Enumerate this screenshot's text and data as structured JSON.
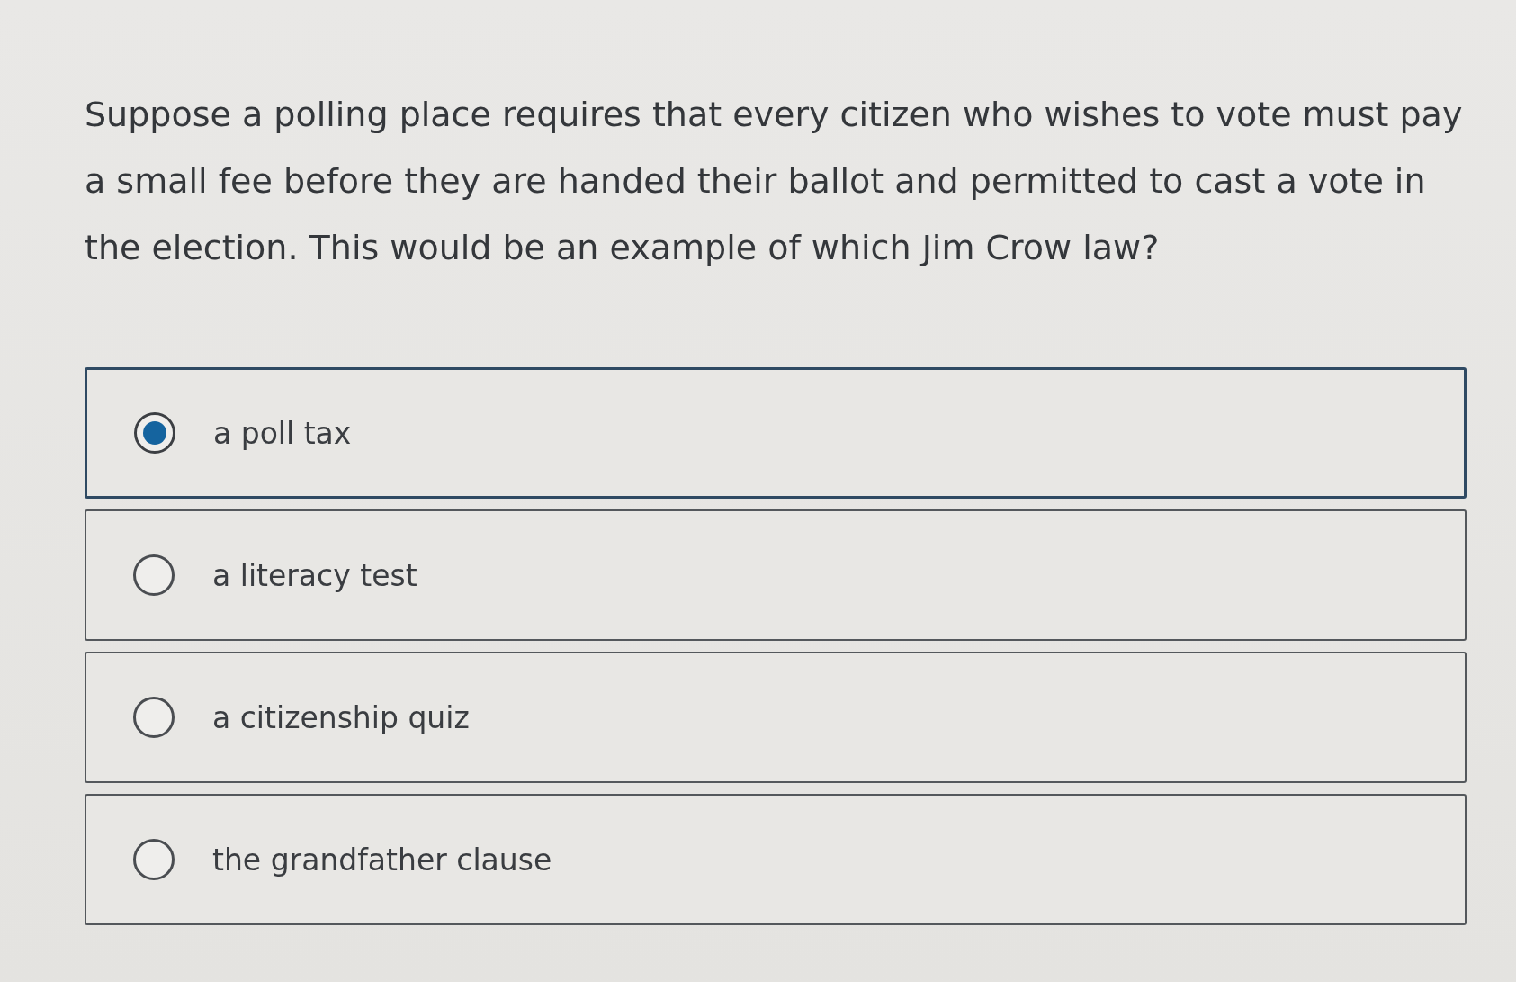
{
  "question": {
    "text": "Suppose a polling place requires that every citizen who wishes to vote must pay a small fee before they are handed their ballot and permitted to cast a vote in the election. This would be an example of which Jim Crow law?"
  },
  "options": [
    {
      "label": "a poll tax",
      "selected": true
    },
    {
      "label": "a literacy test",
      "selected": false
    },
    {
      "label": "a citizenship quiz",
      "selected": false
    },
    {
      "label": "the grandfather clause",
      "selected": false
    }
  ]
}
